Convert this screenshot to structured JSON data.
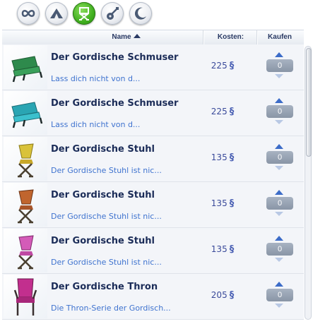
{
  "tabs": [
    {
      "icon": "infinity-icon",
      "active": false
    },
    {
      "icon": "camping-tent-icon",
      "active": false
    },
    {
      "icon": "camp-chair-icon",
      "active": true
    },
    {
      "icon": "guitar-icon",
      "active": false
    },
    {
      "icon": "moon-icon",
      "active": false
    }
  ],
  "columns": {
    "name": "Name",
    "cost": "Kosten:",
    "buy": "Kaufen"
  },
  "currency_symbol": "§",
  "items": [
    {
      "name": "Der Gordische Schmuser",
      "description": "Lass dich nicht von d...",
      "cost": "225",
      "quantity": "0",
      "thumb_icon": "green-loveseat-icon",
      "color": "#2e8a4c"
    },
    {
      "name": "Der Gordische Schmuser",
      "description": "Lass dich nicht von d...",
      "cost": "225",
      "quantity": "0",
      "thumb_icon": "teal-loveseat-icon",
      "color": "#2aa5b3"
    },
    {
      "name": "Der Gordische Stuhl",
      "description": "Der Gordische Stuhl ist nic...",
      "cost": "135",
      "quantity": "0",
      "thumb_icon": "yellow-folding-chair-icon",
      "color": "#d9c23a"
    },
    {
      "name": "Der Gordische Stuhl",
      "description": "Der Gordische Stuhl ist nic...",
      "cost": "135",
      "quantity": "0",
      "thumb_icon": "orange-folding-chair-icon",
      "color": "#c0652e"
    },
    {
      "name": "Der Gordische Stuhl",
      "description": "Der Gordische Stuhl ist nic...",
      "cost": "135",
      "quantity": "0",
      "thumb_icon": "pink-folding-chair-icon",
      "color": "#d45bb8"
    },
    {
      "name": "Der Gordische Thron",
      "description": "Die Thron-Serie der Gordisch...",
      "cost": "205",
      "quantity": "0",
      "thumb_icon": "magenta-throne-chair-icon",
      "color": "#c22f8e"
    }
  ]
}
